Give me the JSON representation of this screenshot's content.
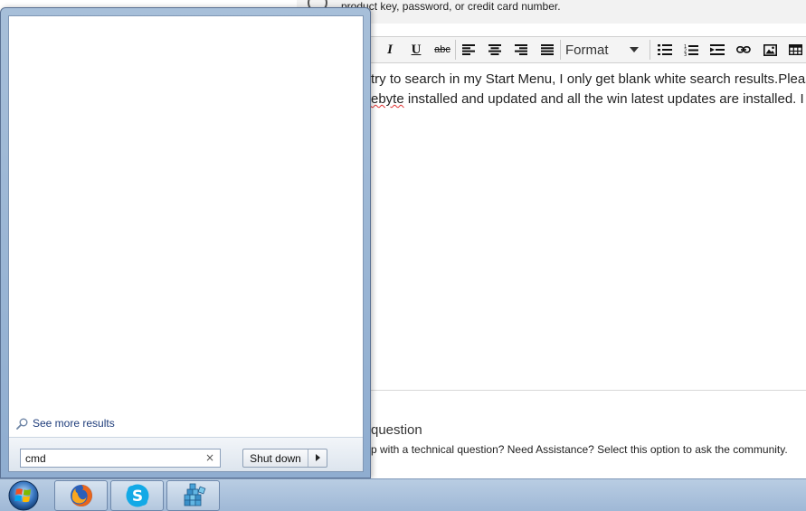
{
  "page": {
    "notice_text": "product key, password, or credit card number.",
    "toolbar": {
      "italic_label": "I",
      "underline_label": "U",
      "strike_label": "abc",
      "format_label": "Format"
    },
    "editor": {
      "line1": "try to search in my Start Menu, I only get blank white search results.Please",
      "line2_spell": "ebyte",
      "line2_rest": " installed and updated and all the win latest updates are installed. I"
    },
    "question_option": {
      "title": "question",
      "description": "p with a technical question? Need Assistance? Select this option to ask the community."
    }
  },
  "start_menu": {
    "see_more_label": "See more results",
    "search_value": "cmd",
    "clear_glyph": "×",
    "shutdown_label": "Shut down"
  },
  "taskbar": {
    "items": [
      "start-orb",
      "firefox",
      "skype",
      "registry-editor"
    ]
  },
  "colors": {
    "menu_frame": "#9fb8d6",
    "link_text": "#1e3c7a",
    "taskbar": "#a9c1dc"
  }
}
